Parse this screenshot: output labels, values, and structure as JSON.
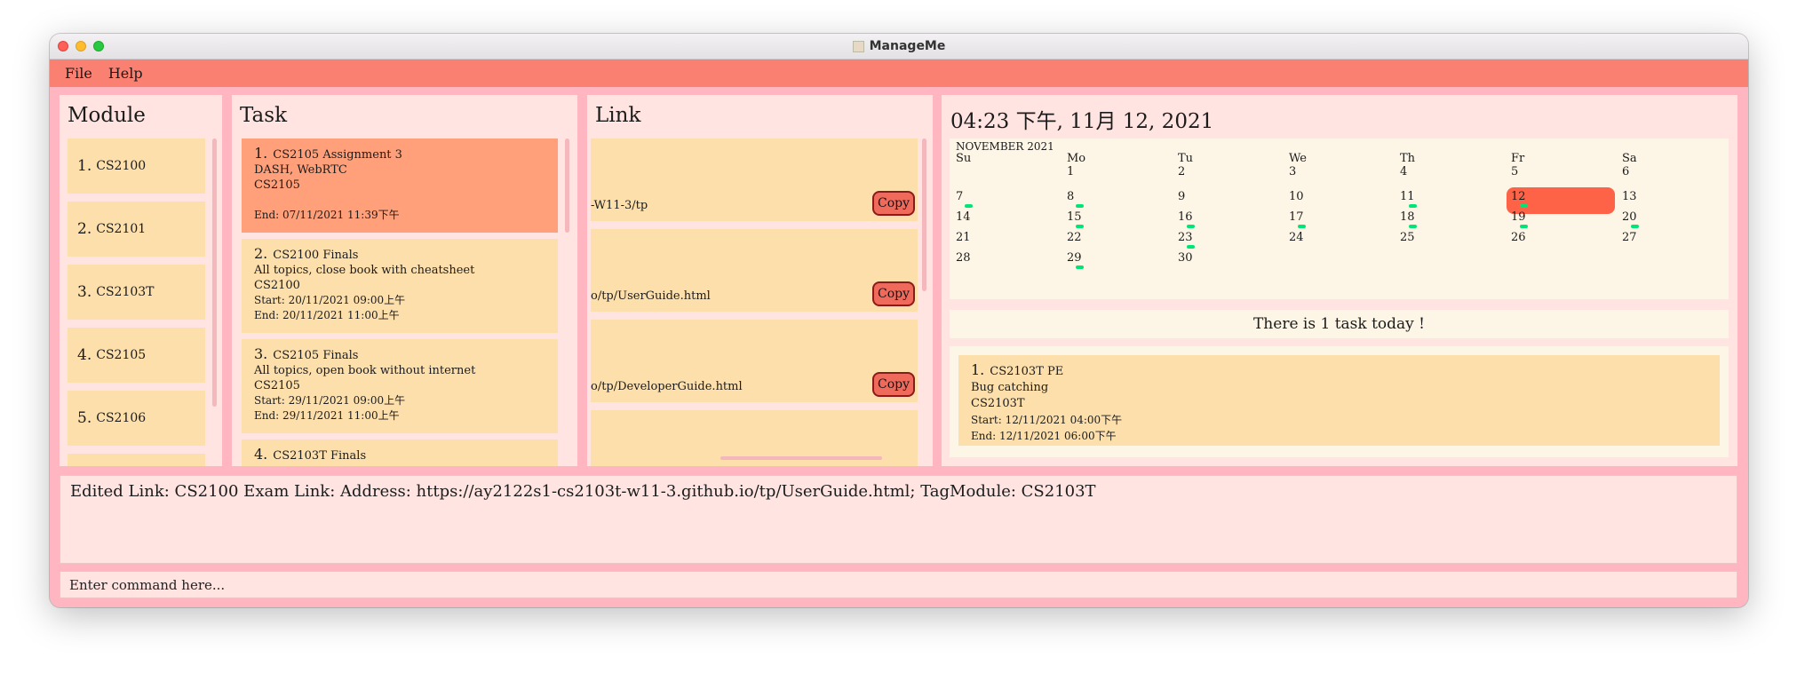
{
  "window": {
    "title": "ManageMe"
  },
  "menu": {
    "file": "File",
    "help": "Help"
  },
  "module_panel": {
    "title": "Module",
    "items": [
      {
        "num": "1.",
        "code": "CS2100"
      },
      {
        "num": "2.",
        "code": "CS2101"
      },
      {
        "num": "3.",
        "code": "CS2103T"
      },
      {
        "num": "4.",
        "code": "CS2105"
      },
      {
        "num": "5.",
        "code": "CS2106"
      }
    ]
  },
  "task_panel": {
    "title": "Task",
    "items": [
      {
        "num": "1.",
        "name": "CS2105 Assignment 3",
        "desc": "DASH, WebRTC",
        "module": "CS2105",
        "start": "",
        "end": "End: 07/11/2021 11:39下午"
      },
      {
        "num": "2.",
        "name": "CS2100 Finals",
        "desc": "All topics, close book with cheatsheet",
        "module": "CS2100",
        "start": "Start: 20/11/2021 09:00上午",
        "end": "End: 20/11/2021 11:00上午"
      },
      {
        "num": "3.",
        "name": "CS2105 Finals",
        "desc": "All topics, open book without internet",
        "module": "CS2105",
        "start": "Start: 29/11/2021 09:00上午",
        "end": "End: 29/11/2021 11:00上午"
      },
      {
        "num": "4.",
        "name": "CS2103T Finals"
      }
    ]
  },
  "link_panel": {
    "title": "Link",
    "copy_label": "Copy",
    "items": [
      {
        "address": "-W11-3/tp"
      },
      {
        "address": "o/tp/UserGuide.html"
      },
      {
        "address": "o/tp/DeveloperGuide.html"
      }
    ]
  },
  "calendar": {
    "datetime": "04:23 下午, 11月 12, 2021",
    "month_label": "NOVEMBER 2021",
    "weekdays": [
      "Su",
      "Mo",
      "Tu",
      "We",
      "Th",
      "Fr",
      "Sa"
    ],
    "first_weekday": 1,
    "days_in_month": 30,
    "selected_day": 12,
    "days_with_tasks": [
      7,
      8,
      11,
      12,
      15,
      16,
      17,
      18,
      19,
      20,
      23,
      29
    ],
    "today_message": "There is 1 task today !",
    "today_tasks": [
      {
        "num": "1.",
        "name": "CS2103T PE",
        "desc": "Bug catching",
        "module": "CS2103T",
        "start": "Start: 12/11/2021 04:00下午",
        "end": "End: 12/11/2021 06:00下午"
      }
    ]
  },
  "result": "Edited Link: CS2100 Exam Link: Address: https://ay2122s1-cs2103t-w11-3.github.io/tp/UserGuide.html; TagModule: CS2103T",
  "command": {
    "placeholder": "Enter command here..."
  },
  "colors": {
    "background": "#ffb6c1",
    "menubar": "#fa8072",
    "panel": "#ffe4e1",
    "card": "#fddfac",
    "selected_card": "#ffa07a",
    "calendar_bg": "#fdf5e6",
    "selected_day": "#ff6347",
    "task_marker": "#00e676"
  }
}
